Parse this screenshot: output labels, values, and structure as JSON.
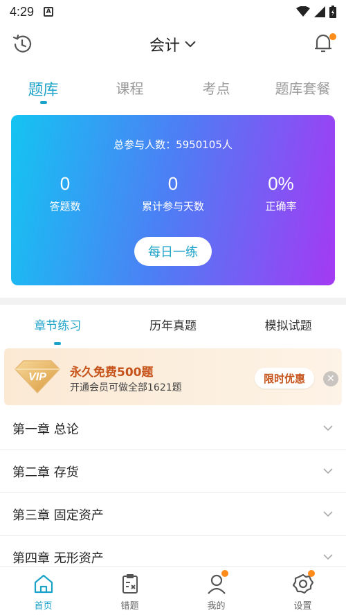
{
  "status_bar": {
    "time": "4:29",
    "notif_letter": "A"
  },
  "header": {
    "title": "会计"
  },
  "main_tabs": [
    {
      "label": "题库"
    },
    {
      "label": "课程"
    },
    {
      "label": "考点"
    },
    {
      "label": "题库套餐"
    }
  ],
  "stats": {
    "total_label": "总参与人数：",
    "total_value": "5950105人",
    "items": [
      {
        "value": "0",
        "label": "答题数"
      },
      {
        "value": "0",
        "label": "累计参与天数"
      },
      {
        "value": "0%",
        "label": "正确率"
      }
    ],
    "daily_button": "每日一练"
  },
  "sub_tabs": [
    {
      "label": "章节练习"
    },
    {
      "label": "历年真题"
    },
    {
      "label": "模拟试题"
    }
  ],
  "vip": {
    "badge": "VIP",
    "title": "永久免费500题",
    "subtitle": "开通会员可做全部1621题",
    "offer_button": "限时优惠",
    "close": "✕"
  },
  "chapters": [
    {
      "label": "第一章 总论"
    },
    {
      "label": "第二章 存货"
    },
    {
      "label": "第三章 固定资产"
    },
    {
      "label": "第四章 无形资产"
    }
  ],
  "bottom_nav": [
    {
      "label": "首页"
    },
    {
      "label": "错题"
    },
    {
      "label": "我的"
    },
    {
      "label": "设置"
    }
  ],
  "colors": {
    "accent": "#1ba2c9",
    "badge_dot": "#ff8c1a",
    "vip_text": "#c6531a"
  }
}
